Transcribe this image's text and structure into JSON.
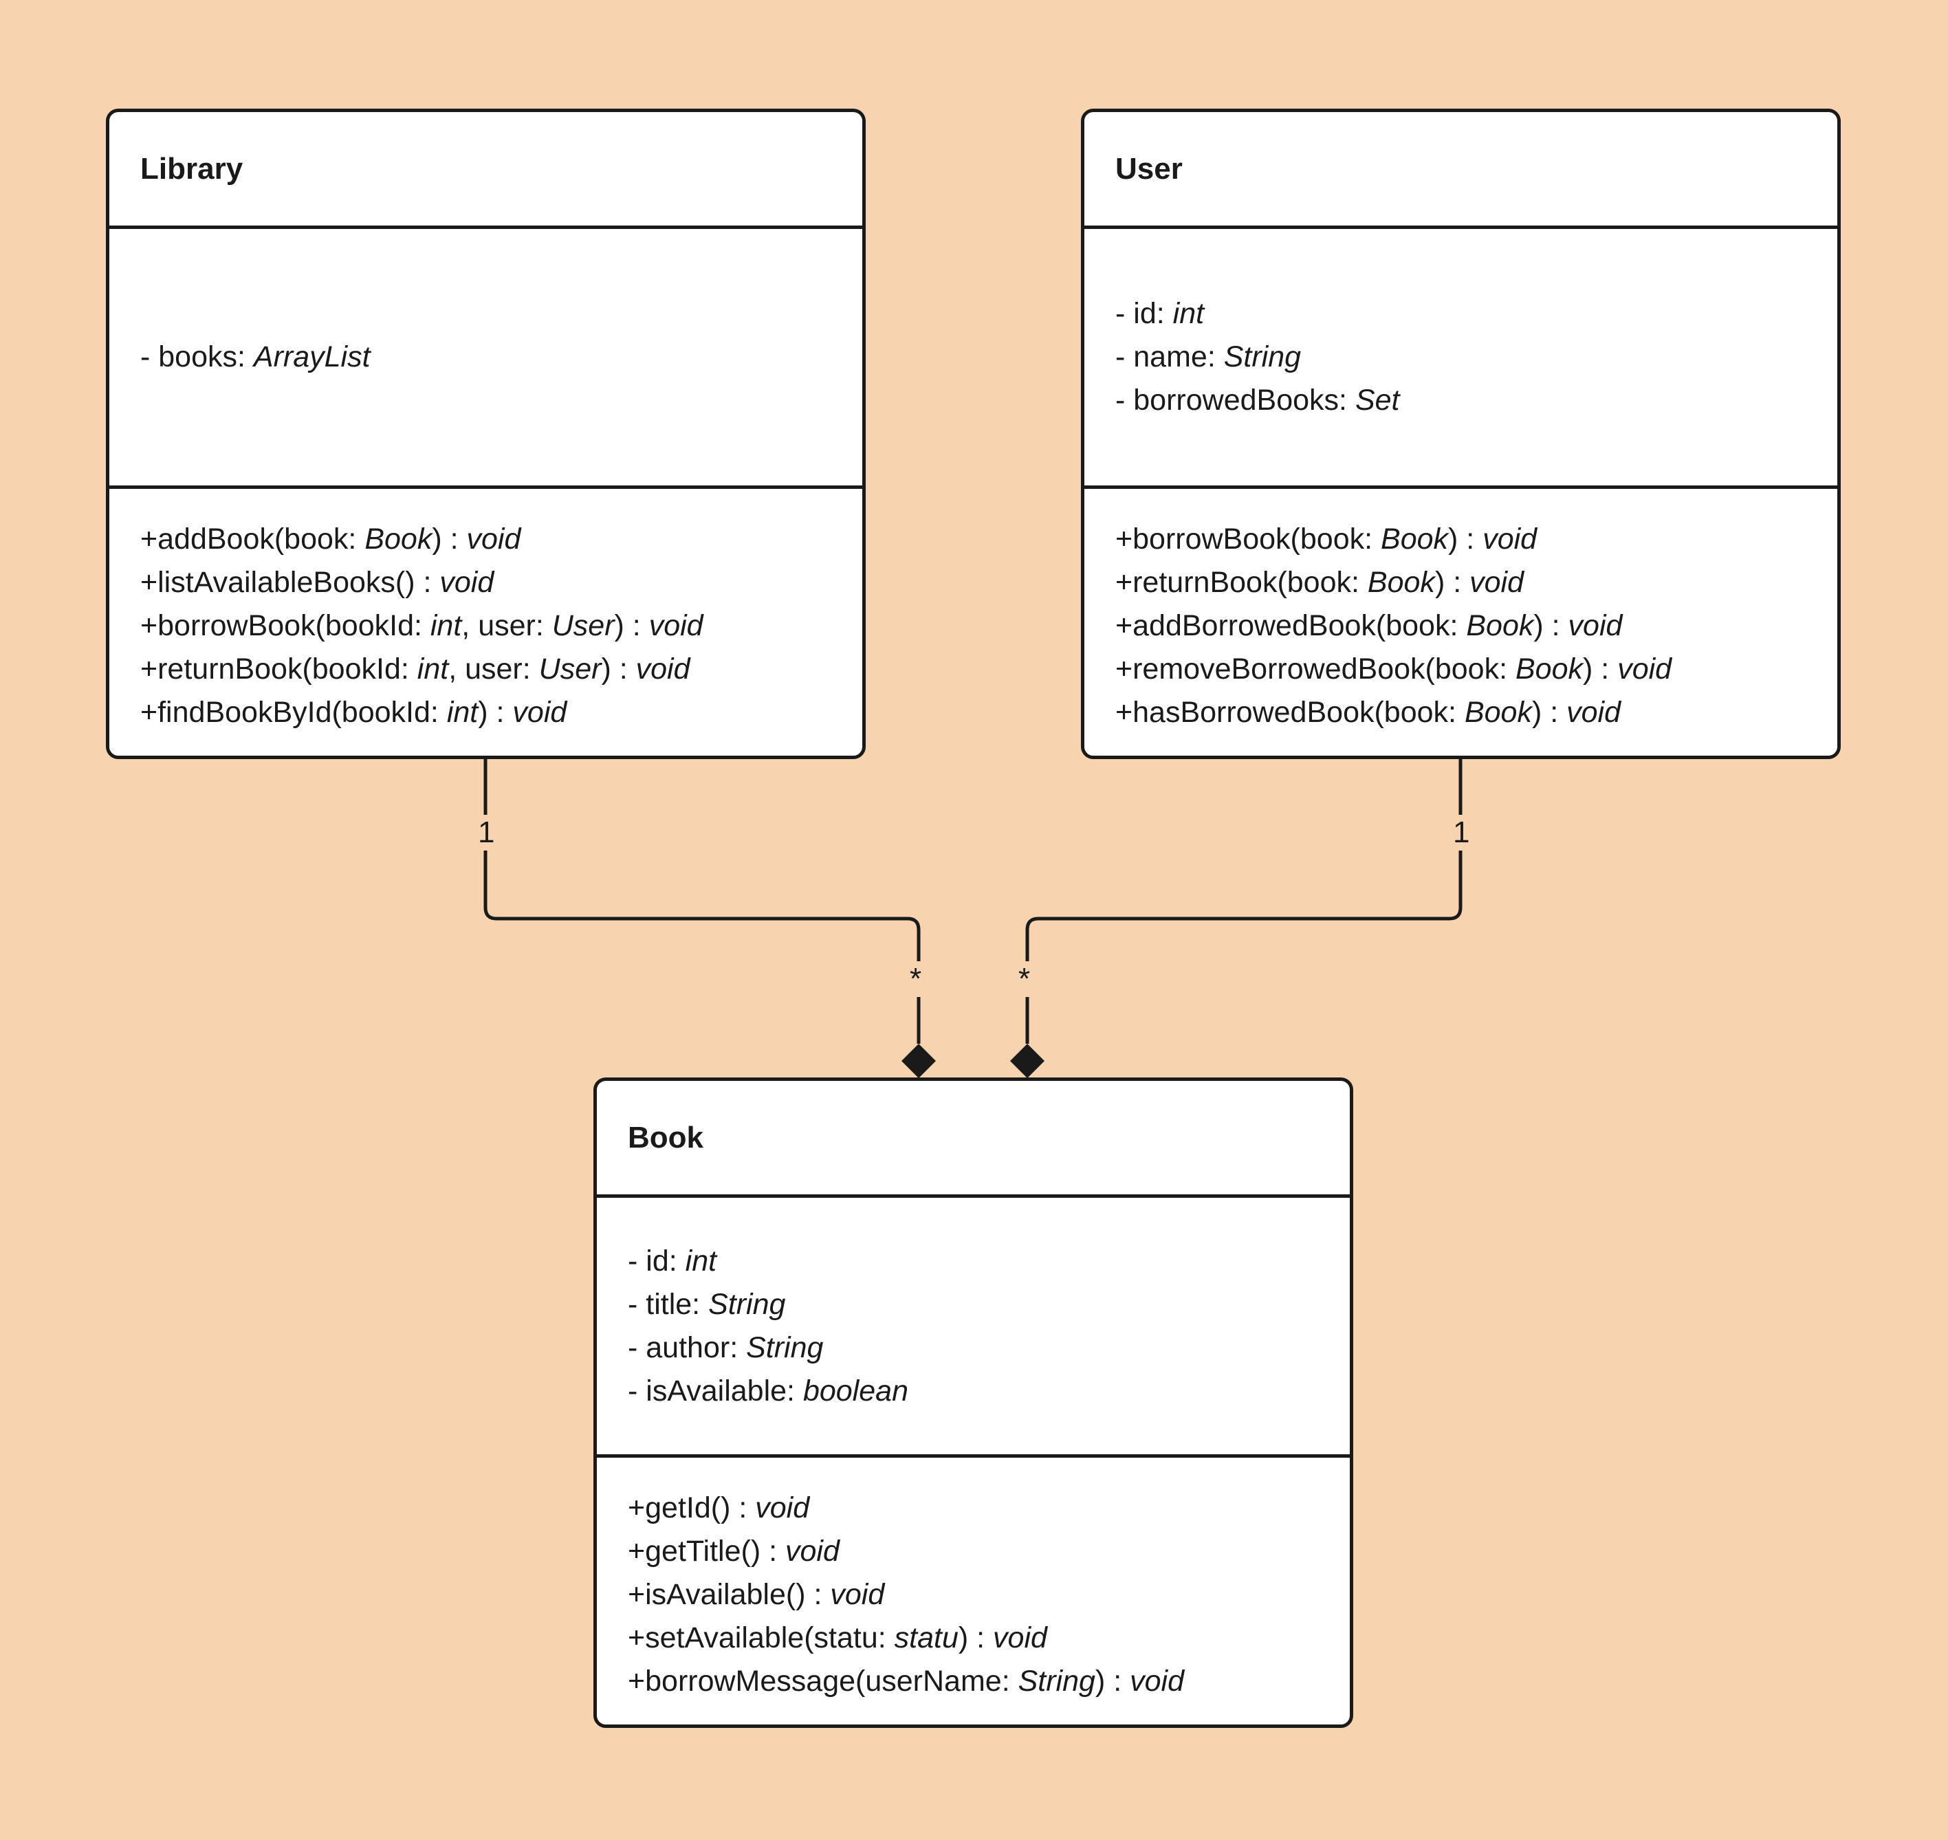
{
  "classes": {
    "library": {
      "name": "Library",
      "attributes": [
        [
          {
            "t": "- books: "
          },
          {
            "t": "ArrayList",
            "i": true
          }
        ]
      ],
      "operations": [
        [
          {
            "t": "+addBook(book: "
          },
          {
            "t": "Book",
            "i": true
          },
          {
            "t": ") : "
          },
          {
            "t": "void",
            "i": true
          }
        ],
        [
          {
            "t": "+listAvailableBooks() : "
          },
          {
            "t": "void",
            "i": true
          }
        ],
        [
          {
            "t": "+borrowBook(bookId: "
          },
          {
            "t": "int",
            "i": true
          },
          {
            "t": ", user: "
          },
          {
            "t": "User",
            "i": true
          },
          {
            "t": ") : "
          },
          {
            "t": "void",
            "i": true
          }
        ],
        [
          {
            "t": "+returnBook(bookId: "
          },
          {
            "t": "int",
            "i": true
          },
          {
            "t": ", user: "
          },
          {
            "t": "User",
            "i": true
          },
          {
            "t": ") : "
          },
          {
            "t": "void",
            "i": true
          }
        ],
        [
          {
            "t": "+findBookById(bookId: "
          },
          {
            "t": "int",
            "i": true
          },
          {
            "t": ") : "
          },
          {
            "t": "void",
            "i": true
          }
        ]
      ]
    },
    "user": {
      "name": "User",
      "attributes": [
        [
          {
            "t": "- id: "
          },
          {
            "t": "int",
            "i": true
          }
        ],
        [
          {
            "t": "- name: "
          },
          {
            "t": "String",
            "i": true
          }
        ],
        [
          {
            "t": "- borrowedBooks: "
          },
          {
            "t": "Set",
            "i": true
          }
        ]
      ],
      "operations": [
        [
          {
            "t": "+borrowBook(book: "
          },
          {
            "t": "Book",
            "i": true
          },
          {
            "t": ") : "
          },
          {
            "t": "void",
            "i": true
          }
        ],
        [
          {
            "t": "+returnBook(book: "
          },
          {
            "t": "Book",
            "i": true
          },
          {
            "t": ") : "
          },
          {
            "t": "void",
            "i": true
          }
        ],
        [
          {
            "t": "+addBorrowedBook(book: "
          },
          {
            "t": "Book",
            "i": true
          },
          {
            "t": ") : "
          },
          {
            "t": "void",
            "i": true
          }
        ],
        [
          {
            "t": "+removeBorrowedBook(book: "
          },
          {
            "t": "Book",
            "i": true
          },
          {
            "t": ") : "
          },
          {
            "t": "void",
            "i": true
          }
        ],
        [
          {
            "t": "+hasBorrowedBook(book: "
          },
          {
            "t": "Book",
            "i": true
          },
          {
            "t": ") : "
          },
          {
            "t": "void",
            "i": true
          }
        ]
      ]
    },
    "book": {
      "name": "Book",
      "attributes": [
        [
          {
            "t": "- id: "
          },
          {
            "t": "int",
            "i": true
          }
        ],
        [
          {
            "t": "- title: "
          },
          {
            "t": "String",
            "i": true
          }
        ],
        [
          {
            "t": "- author: "
          },
          {
            "t": "String",
            "i": true
          }
        ],
        [
          {
            "t": "- isAvailable: "
          },
          {
            "t": "boolean",
            "i": true
          }
        ]
      ],
      "operations": [
        [
          {
            "t": "+getId() : "
          },
          {
            "t": "void",
            "i": true
          }
        ],
        [
          {
            "t": "+getTitle() : "
          },
          {
            "t": "void",
            "i": true
          }
        ],
        [
          {
            "t": "+isAvailable() : "
          },
          {
            "t": "void",
            "i": true
          }
        ],
        [
          {
            "t": "+setAvailable(statu: "
          },
          {
            "t": "statu",
            "i": true
          },
          {
            "t": ") : "
          },
          {
            "t": "void",
            "i": true
          }
        ],
        [
          {
            "t": "+borrowMessage(userName: "
          },
          {
            "t": "String",
            "i": true
          },
          {
            "t": ") : "
          },
          {
            "t": "void",
            "i": true
          }
        ]
      ]
    }
  },
  "relations": {
    "library_book": {
      "type": "composition",
      "from": "Library",
      "to": "Book",
      "from_multiplicity": "1",
      "to_multiplicity": "*"
    },
    "user_book": {
      "type": "composition",
      "from": "User",
      "to": "Book",
      "from_multiplicity": "1",
      "to_multiplicity": "*"
    }
  },
  "colors": {
    "background": "#f7d3b0",
    "box": "#ffffff",
    "line": "#1a1a1a"
  }
}
